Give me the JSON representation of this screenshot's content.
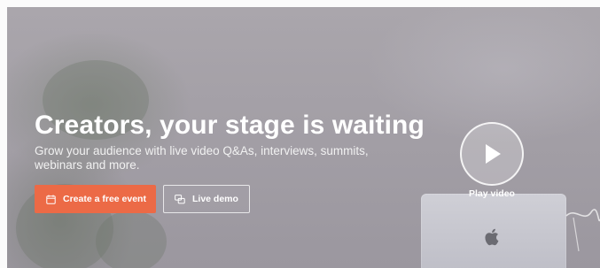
{
  "hero": {
    "headline": "Creators, your stage is waiting",
    "subheadline": "Grow your audience with live video Q&As, interviews, summits, webinars and more.",
    "primary_cta": {
      "label": "Create a free event",
      "icon": "calendar-icon"
    },
    "secondary_cta": {
      "label": "Live demo",
      "icon": "live-demo-icon"
    },
    "video": {
      "label": "Play video",
      "icon": "play-icon"
    }
  },
  "colors": {
    "accent": "#ec6a46",
    "text": "#ffffff",
    "overlay": "#a39fa6"
  }
}
